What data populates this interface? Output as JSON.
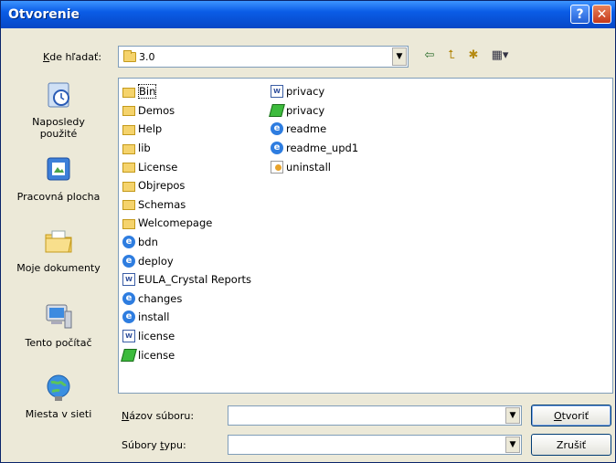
{
  "window": {
    "title": "Otvorenie",
    "help_symbol": "?",
    "close_symbol": "✕"
  },
  "look_in": {
    "label_accel": "K",
    "label_rest": "de hľadať:",
    "value": "3.0"
  },
  "toolbar": [
    {
      "name": "back-icon",
      "glyph": "⇦"
    },
    {
      "name": "up-folder-icon",
      "glyph": "⮤"
    },
    {
      "name": "new-folder-icon",
      "glyph": "✱"
    },
    {
      "name": "views-menu-icon",
      "glyph": "▦▾"
    }
  ],
  "places": [
    {
      "label": "Naposledy\npoužité",
      "icon": "recent-icon"
    },
    {
      "label": "Pracovná plocha",
      "icon": "desktop-icon"
    },
    {
      "label": "Moje dokumenty",
      "icon": "my-documents-icon"
    },
    {
      "label": "Tento počítač",
      "icon": "my-computer-icon"
    },
    {
      "label": "Miesta v sieti",
      "icon": "network-places-icon"
    }
  ],
  "files_col1": [
    {
      "name": "Bin",
      "type": "folder"
    },
    {
      "name": "Demos",
      "type": "folder"
    },
    {
      "name": "Help",
      "type": "folder"
    },
    {
      "name": "lib",
      "type": "folder"
    },
    {
      "name": "License",
      "type": "folder"
    },
    {
      "name": "Objrepos",
      "type": "folder"
    },
    {
      "name": "Schemas",
      "type": "folder"
    },
    {
      "name": "Welcomepage",
      "type": "folder"
    },
    {
      "name": "bdn",
      "type": "ie"
    },
    {
      "name": "deploy",
      "type": "ie"
    },
    {
      "name": "EULA_Crystal Reports",
      "type": "word"
    },
    {
      "name": "changes",
      "type": "ie"
    },
    {
      "name": "install",
      "type": "ie"
    },
    {
      "name": "license",
      "type": "word"
    },
    {
      "name": "license",
      "type": "gdoc"
    }
  ],
  "files_col2": [
    {
      "name": "privacy",
      "type": "word"
    },
    {
      "name": "privacy",
      "type": "gdoc"
    },
    {
      "name": "readme",
      "type": "ie"
    },
    {
      "name": "readme_upd1",
      "type": "ie"
    },
    {
      "name": "uninstall",
      "type": "unin"
    }
  ],
  "file_name": {
    "label_accel": "N",
    "label_rest": "ázov súboru:",
    "value": ""
  },
  "file_type": {
    "label_pre": "Súbory ",
    "label_accel": "t",
    "label_rest": "ypu:",
    "value": ""
  },
  "buttons": {
    "open_accel": "O",
    "open_rest": "tvoriť",
    "cancel": "Zrušiť"
  }
}
